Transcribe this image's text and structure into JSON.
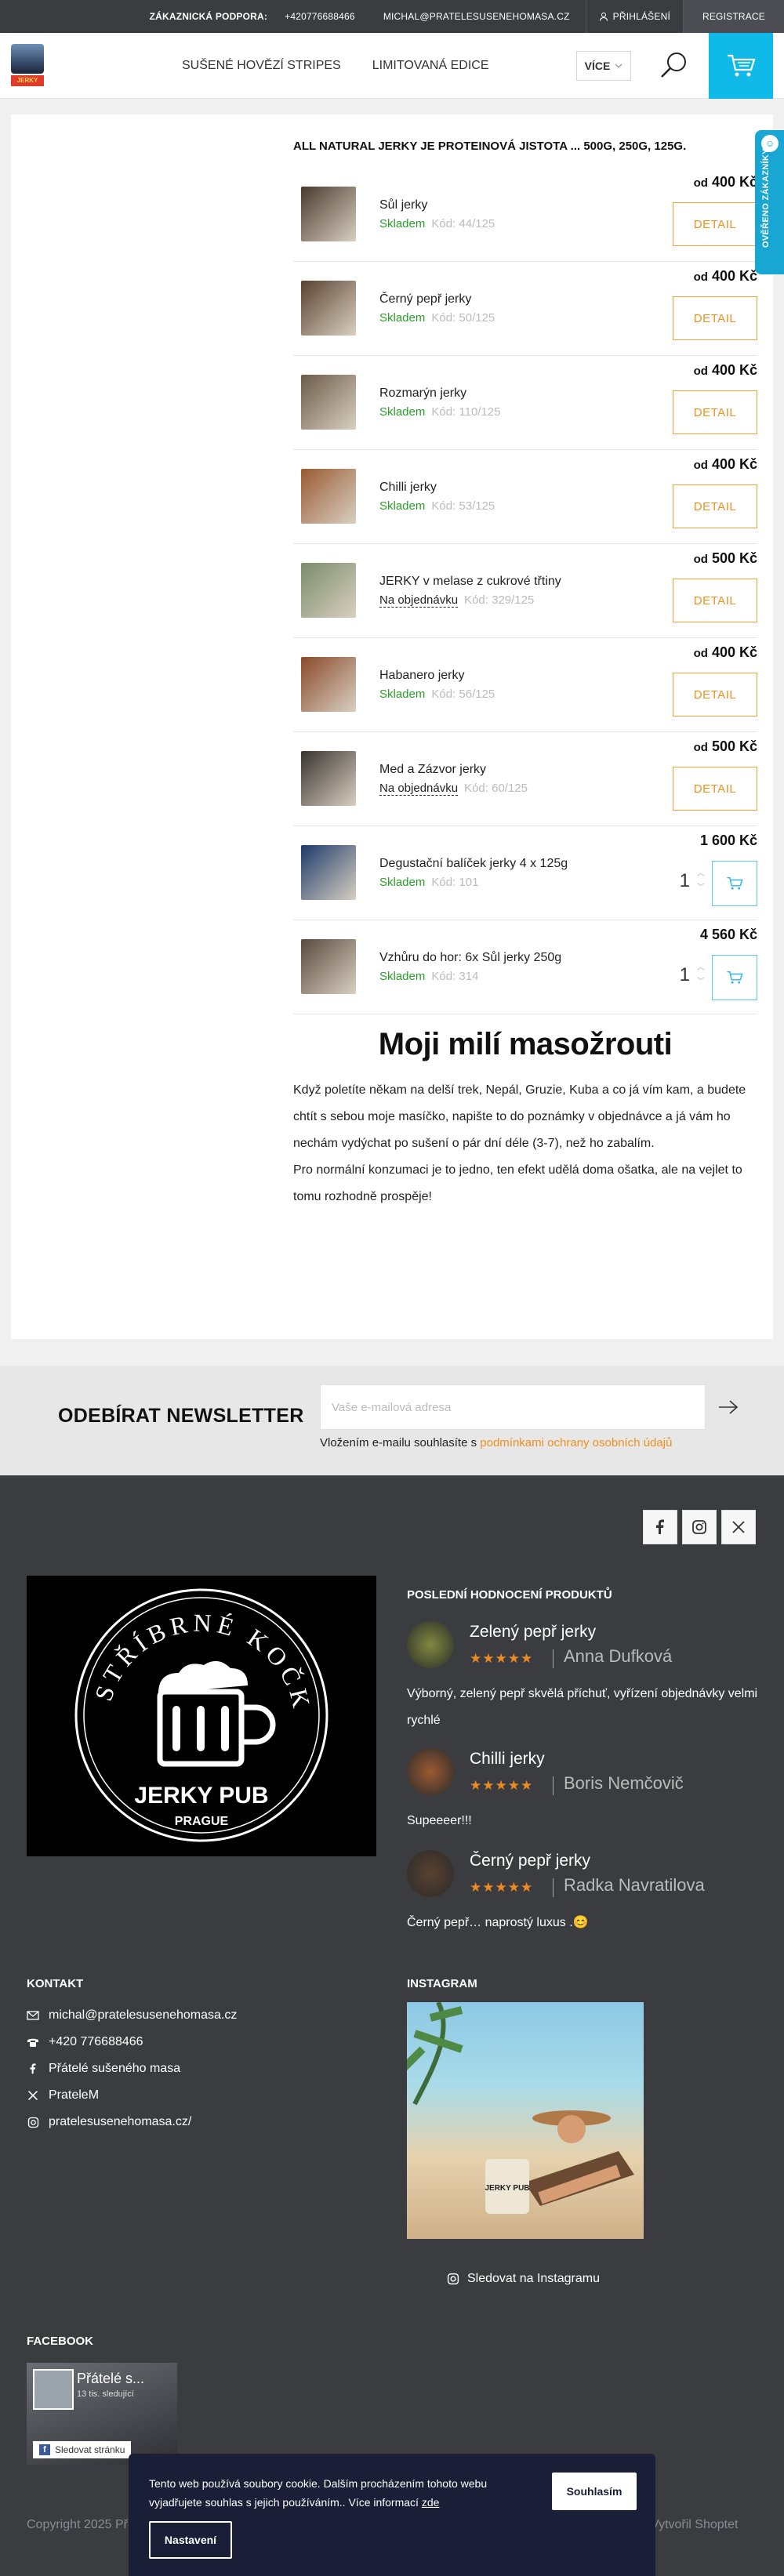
{
  "topbar": {
    "support_label": "ZÁKAZNICKÁ PODPORA:",
    "phone": "+420776688466",
    "email": "MICHAL@PRATELESUSENEHOMASA.CZ",
    "login": "PŘIHLÁŠENÍ",
    "register": "REGISTRACE"
  },
  "header": {
    "logo_badge": "JERKY",
    "nav": [
      "SUŠENÉ HOVĚZÍ STRIPES",
      "LIMITOVANÁ EDICE"
    ],
    "more": "VÍCE"
  },
  "main": {
    "intro": "ALL NATURAL JERKY JE PROTEINOVÁ JISTOTA ... 500G, 250G, 125G.",
    "products": [
      {
        "name": "Sůl jerky",
        "stock": "Skladem",
        "code": "Kód: 44/125",
        "price_prefix": "od",
        "price": "400 Kč",
        "action": "DETAIL",
        "thumb": "#4a3a2e"
      },
      {
        "name": "Černý pepř jerky",
        "stock": "Skladem",
        "code": "Kód: 50/125",
        "price_prefix": "od",
        "price": "400 Kč",
        "action": "DETAIL",
        "thumb": "#5a4230"
      },
      {
        "name": "Rozmarýn jerky",
        "stock": "Skladem",
        "code": "Kód: 110/125",
        "price_prefix": "od",
        "price": "400 Kč",
        "action": "DETAIL",
        "thumb": "#6c5b49"
      },
      {
        "name": "Chilli jerky",
        "stock": "Skladem",
        "code": "Kód: 53/125",
        "price_prefix": "od",
        "price": "400 Kč",
        "action": "DETAIL",
        "thumb": "#9a5a32"
      },
      {
        "name": "JERKY v melase z cukrové třtiny",
        "stock": "Na objednávku",
        "code": "Kód: 329/125",
        "price_prefix": "od",
        "price": "500 Kč",
        "action": "DETAIL",
        "thumb": "#7b8c6a"
      },
      {
        "name": "Habanero jerky",
        "stock": "Skladem",
        "code": "Kód: 56/125",
        "price_prefix": "od",
        "price": "400 Kč",
        "action": "DETAIL",
        "thumb": "#8a4a2a"
      },
      {
        "name": "Med a Zázvor jerky",
        "stock": "Na objednávku",
        "code": "Kód: 60/125",
        "price_prefix": "od",
        "price": "500 Kč",
        "action": "DETAIL",
        "thumb": "#3a3430"
      },
      {
        "name": "Degustační balíček jerky 4 x 125g",
        "stock": "Skladem",
        "code": "Kód: 101",
        "price_prefix": "",
        "price": "1 600 Kč",
        "qty": "1",
        "thumb": "#1c3a6a"
      },
      {
        "name": "Vzhůru do hor: 6x Sůl jerky 250g",
        "stock": "Skladem",
        "code": "Kód: 314",
        "price_prefix": "",
        "price": "4 560 Kč",
        "qty": "1",
        "thumb": "#5a4a3e"
      }
    ],
    "heading": "Moji milí masožrouti",
    "paragraph1": "Když poletíte někam na delší trek, Nepál, Gruzie, Kuba a co já vím kam, a budete chtít s sebou moje masíčko, napište to do poznámky v objednávce a já vám ho nechám vydýchat po sušení o pár dní déle (3-7), než ho zabalím.",
    "paragraph2": "Pro normální konzumaci je to jedno, ten efekt udělá doma ošatka, ale na vejlet to tomu rozhodně prospěje!",
    "verified_badge": "OVĚŘENO ZÁKAZNÍKY"
  },
  "newsletter": {
    "title": "ODEBÍRAT NEWSLETTER",
    "placeholder": "Vaše e-mailová adresa",
    "consent_prefix": "Vložením e-mailu souhlasíte s",
    "consent_link": "podmínkami ochrany osobních údajů"
  },
  "footer": {
    "pub_ring_text": "U STŘÍBRNÉ KOČKY",
    "pub_name": "JERKY PUB",
    "pub_city": "PRAGUE",
    "reviews_title": "POSLEDNÍ HODNOCENÍ PRODUKTŮ",
    "reviews": [
      {
        "product": "Zelený pepř jerky",
        "author": "Anna Dufková",
        "stars": "★★★★★",
        "text": "Výborný, zelený pepř skvělá příchuť, vyřízení objednávky velmi rychlé",
        "color": "#7f8a3e"
      },
      {
        "product": "Chilli jerky",
        "author": "Boris Nemčovič",
        "stars": "★★★★★",
        "text": "Supeeeer!!!",
        "color": "#9a5a32"
      },
      {
        "product": "Černý pepř jerky",
        "author": "Radka Navratilova",
        "stars": "★★★★★",
        "text": "Černý pepř… naprostý luxus .😊",
        "color": "#5a4230"
      }
    ],
    "contact_title": "KONTAKT",
    "contacts": [
      {
        "icon": "mail-icon",
        "text": "michal@pratelesusenehomasa.cz"
      },
      {
        "icon": "phone-icon",
        "text": "+420 776688466"
      },
      {
        "icon": "facebook-icon",
        "text": "Přátelé sušeného masa"
      },
      {
        "icon": "x-icon",
        "text": "PrateleM"
      },
      {
        "icon": "instagram-icon",
        "text": "pratelesusenehomasa.cz/"
      }
    ],
    "instagram_title": "INSTAGRAM",
    "instagram_bag": "JERKY PUB",
    "instagram_follow": "Sledovat na Instagramu",
    "facebook_title": "FACEBOOK",
    "fb_page": "Přátelé s...",
    "fb_followers": "13 tis. sledující",
    "fb_follow_btn": "Sledovat stránku",
    "copyright": "Copyright 2025 Př",
    "made_by": "Vytvořil Shoptet"
  },
  "cookie": {
    "text": "Tento web používá soubory cookie. Dalším procházením tohoto webu vyjadřujete souhlas s jejich používáním.. Více informací",
    "link": "zde",
    "accept": "Souhlasím",
    "settings": "Nastavení"
  },
  "colors": {
    "accent_orange": "#f0901c",
    "accent_blue": "#0fb9e8",
    "stock_green": "#2a9f2a",
    "footer_bg": "#3b3c40"
  }
}
